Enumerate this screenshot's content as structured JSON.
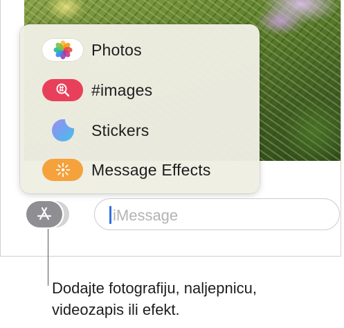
{
  "apps_menu": {
    "items": [
      {
        "label": "Photos",
        "icon": "photos-icon"
      },
      {
        "label": "#images",
        "icon": "images-search-icon"
      },
      {
        "label": "Stickers",
        "icon": "stickers-icon"
      },
      {
        "label": "Message Effects",
        "icon": "message-effects-icon"
      }
    ]
  },
  "input_bar": {
    "apps_button_icon": "app-store-icon",
    "placeholder": "iMessage"
  },
  "callout": {
    "line1": "Dodajte fotografiju, naljepnicu,",
    "line2": "videozapis ili efekt."
  },
  "colors": {
    "popover_bg": "#eeeee3",
    "images_icon_bg": "#e8405a",
    "effects_icon_bg": "#f5a23c",
    "apps_button_bg": "#8e8e93",
    "caret": "#2f6fe0"
  }
}
